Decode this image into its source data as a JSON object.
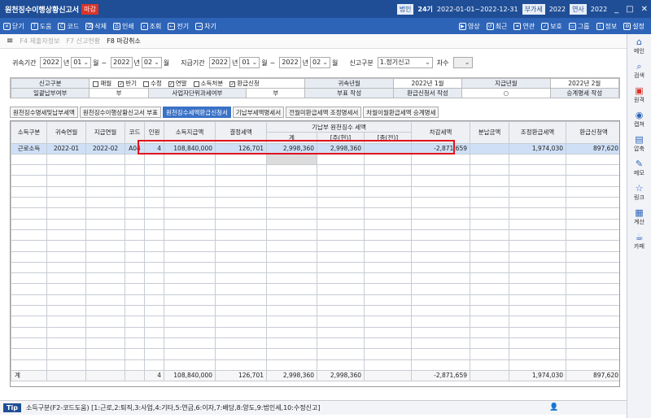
{
  "window": {
    "title": "원천징수이행상황신고서",
    "badge": "마감",
    "kind": "법인",
    "period_label": "24기",
    "period": "2022-01-01~2022-12-31",
    "tag": "부가세",
    "year": "2022",
    "tag2": "연사",
    "year2": "2022",
    "ctrl_min": "_",
    "ctrl_max": "□",
    "ctrl_close": "✕"
  },
  "toolbar": {
    "left": [
      {
        "label": "닫기",
        "icon": "close-icon"
      },
      {
        "label": "도움",
        "icon": "help-icon"
      },
      {
        "label": "코드",
        "icon": "code-icon"
      },
      {
        "label": "삭제",
        "icon": "trash-icon"
      },
      {
        "label": "인쇄",
        "icon": "print-icon"
      },
      {
        "label": "조회",
        "icon": "search-icon"
      },
      {
        "label": "전기",
        "icon": "post-icon"
      },
      {
        "label": "차기",
        "icon": "next-icon"
      }
    ],
    "right": [
      {
        "label": "영상",
        "icon": "video-icon"
      },
      {
        "label": "최근",
        "icon": "recent-icon"
      },
      {
        "label": "연관",
        "icon": "link-icon"
      },
      {
        "label": "보호",
        "icon": "shield-icon"
      },
      {
        "label": "그룹",
        "icon": "group-icon"
      },
      {
        "label": "정보",
        "icon": "info-icon"
      },
      {
        "label": "설정",
        "icon": "gear-icon"
      }
    ]
  },
  "fkeys": [
    {
      "label": "F4 제출자정보",
      "active": false
    },
    {
      "label": "F7 신고현황",
      "active": false
    },
    {
      "label": "F8 마감취소",
      "active": true
    }
  ],
  "filters": {
    "l1": "귀속기간",
    "y1": "2022",
    "t_year": "년",
    "m1": "01",
    "t_month": "월",
    "dash": "~",
    "y2": "2022",
    "m2": "02",
    "l2": "지급기간",
    "y3": "2022",
    "m3": "01",
    "y4": "2022",
    "m4": "02",
    "l3": "신고구분",
    "report_type": "1.정기신고",
    "l4": "차수",
    "round": ""
  },
  "info": {
    "r1": {
      "c1": "신고구분",
      "opts": [
        "매월",
        "반기",
        "수정",
        "연말",
        "소득처분",
        "환급신청"
      ],
      "checked": [
        false,
        true,
        false,
        true,
        false,
        true
      ],
      "c3": "귀속년월",
      "v3": "2022년 1월",
      "c4": "지급년월",
      "v4": "2022년 2월"
    },
    "r2": {
      "c1": "일괄납부여부",
      "v1": "부",
      "c2": "사업자단위과세여부",
      "v2": "부",
      "c3": "부표 작성",
      "c4": "환급신청서 작성",
      "v4": "○",
      "c5": "승계명세 작성"
    }
  },
  "tabs": [
    "원천징수명세및납부세액",
    "원천징수이행상황신고서 부표",
    "원천징수세액환급신청서",
    "기납부세액명세서",
    "전월미환급세액 조정명세서",
    "차월이월환급세액 승계명세"
  ],
  "active_tab": 2,
  "grid": {
    "headers": {
      "type": "소득구분",
      "belong": "귀속연월",
      "pay": "지급연월",
      "code": "코드",
      "people": "인원",
      "income": "소득지급액",
      "decided": "결정세액",
      "prepaid": "기납부 원천징수 세액",
      "sub_total": "계",
      "sub_main": "[주(현)]",
      "sub_prev": "[종(전)]",
      "diff": "차감세액",
      "split": "분납금액",
      "adjust": "조정환급세액",
      "refund": "환급신청액"
    },
    "rows": [
      {
        "type": "근로소득",
        "belong": "2022-01",
        "pay": "2022-02",
        "code": "A04",
        "people": "4",
        "income": "108,840,000",
        "decided": "126,701",
        "total": "2,998,360",
        "main": "2,998,360",
        "prev": "",
        "diff": "-2,871,659",
        "split": "",
        "adjust": "1,974,030",
        "refund": "897,620"
      }
    ],
    "total": {
      "label": "계",
      "people": "4",
      "income": "108,840,000",
      "decided": "126,701",
      "total": "2,998,360",
      "main": "2,998,360",
      "prev": "",
      "diff": "-2,871,659",
      "split": "",
      "adjust": "1,974,030",
      "refund": "897,620"
    }
  },
  "tip": {
    "label": "Tip",
    "text": "소득구분(F2-코드도움) [1:근로,2:퇴직,3:사업,4:기타,5:연금,6:이자,7:배당,8:양도,9:법인세,10:수정신고]"
  },
  "sidebar": [
    {
      "label": "메인",
      "icon": "home-icon",
      "red": false
    },
    {
      "label": "검색",
      "icon": "search-icon",
      "red": false
    },
    {
      "label": "원격",
      "icon": "remote-icon",
      "red": true
    },
    {
      "label": "캡쳐",
      "icon": "camera-icon",
      "red": false
    },
    {
      "label": "압축",
      "icon": "zip-icon",
      "red": false
    },
    {
      "label": "메모",
      "icon": "memo-icon",
      "red": false
    },
    {
      "label": "링크",
      "icon": "star-icon",
      "red": false
    },
    {
      "label": "계산",
      "icon": "calculator-icon",
      "red": false
    },
    {
      "label": "카페",
      "icon": "cafe-icon",
      "red": false
    }
  ]
}
